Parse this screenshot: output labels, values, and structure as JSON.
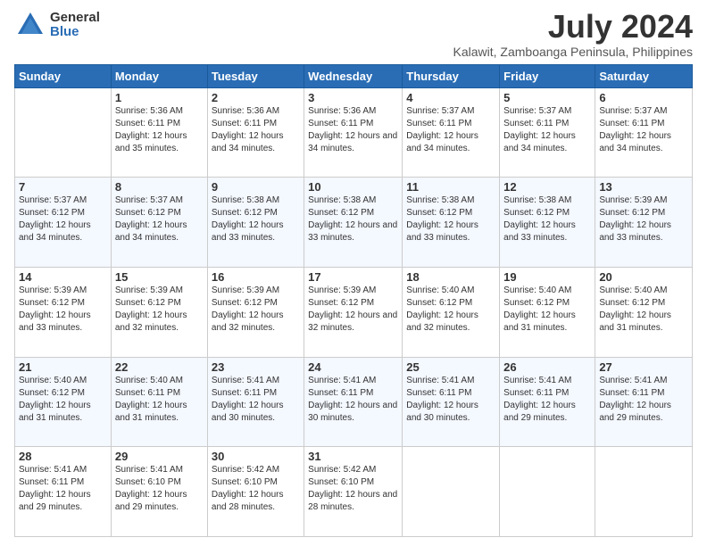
{
  "logo": {
    "general": "General",
    "blue": "Blue"
  },
  "header": {
    "month_title": "July 2024",
    "location": "Kalawit, Zamboanga Peninsula, Philippines"
  },
  "days_of_week": [
    "Sunday",
    "Monday",
    "Tuesday",
    "Wednesday",
    "Thursday",
    "Friday",
    "Saturday"
  ],
  "weeks": [
    [
      {
        "day": "",
        "sunrise": "",
        "sunset": "",
        "daylight": ""
      },
      {
        "day": "1",
        "sunrise": "Sunrise: 5:36 AM",
        "sunset": "Sunset: 6:11 PM",
        "daylight": "Daylight: 12 hours and 35 minutes."
      },
      {
        "day": "2",
        "sunrise": "Sunrise: 5:36 AM",
        "sunset": "Sunset: 6:11 PM",
        "daylight": "Daylight: 12 hours and 34 minutes."
      },
      {
        "day": "3",
        "sunrise": "Sunrise: 5:36 AM",
        "sunset": "Sunset: 6:11 PM",
        "daylight": "Daylight: 12 hours and 34 minutes."
      },
      {
        "day": "4",
        "sunrise": "Sunrise: 5:37 AM",
        "sunset": "Sunset: 6:11 PM",
        "daylight": "Daylight: 12 hours and 34 minutes."
      },
      {
        "day": "5",
        "sunrise": "Sunrise: 5:37 AM",
        "sunset": "Sunset: 6:11 PM",
        "daylight": "Daylight: 12 hours and 34 minutes."
      },
      {
        "day": "6",
        "sunrise": "Sunrise: 5:37 AM",
        "sunset": "Sunset: 6:11 PM",
        "daylight": "Daylight: 12 hours and 34 minutes."
      }
    ],
    [
      {
        "day": "7",
        "sunrise": "Sunrise: 5:37 AM",
        "sunset": "Sunset: 6:12 PM",
        "daylight": "Daylight: 12 hours and 34 minutes."
      },
      {
        "day": "8",
        "sunrise": "Sunrise: 5:37 AM",
        "sunset": "Sunset: 6:12 PM",
        "daylight": "Daylight: 12 hours and 34 minutes."
      },
      {
        "day": "9",
        "sunrise": "Sunrise: 5:38 AM",
        "sunset": "Sunset: 6:12 PM",
        "daylight": "Daylight: 12 hours and 33 minutes."
      },
      {
        "day": "10",
        "sunrise": "Sunrise: 5:38 AM",
        "sunset": "Sunset: 6:12 PM",
        "daylight": "Daylight: 12 hours and 33 minutes."
      },
      {
        "day": "11",
        "sunrise": "Sunrise: 5:38 AM",
        "sunset": "Sunset: 6:12 PM",
        "daylight": "Daylight: 12 hours and 33 minutes."
      },
      {
        "day": "12",
        "sunrise": "Sunrise: 5:38 AM",
        "sunset": "Sunset: 6:12 PM",
        "daylight": "Daylight: 12 hours and 33 minutes."
      },
      {
        "day": "13",
        "sunrise": "Sunrise: 5:39 AM",
        "sunset": "Sunset: 6:12 PM",
        "daylight": "Daylight: 12 hours and 33 minutes."
      }
    ],
    [
      {
        "day": "14",
        "sunrise": "Sunrise: 5:39 AM",
        "sunset": "Sunset: 6:12 PM",
        "daylight": "Daylight: 12 hours and 33 minutes."
      },
      {
        "day": "15",
        "sunrise": "Sunrise: 5:39 AM",
        "sunset": "Sunset: 6:12 PM",
        "daylight": "Daylight: 12 hours and 32 minutes."
      },
      {
        "day": "16",
        "sunrise": "Sunrise: 5:39 AM",
        "sunset": "Sunset: 6:12 PM",
        "daylight": "Daylight: 12 hours and 32 minutes."
      },
      {
        "day": "17",
        "sunrise": "Sunrise: 5:39 AM",
        "sunset": "Sunset: 6:12 PM",
        "daylight": "Daylight: 12 hours and 32 minutes."
      },
      {
        "day": "18",
        "sunrise": "Sunrise: 5:40 AM",
        "sunset": "Sunset: 6:12 PM",
        "daylight": "Daylight: 12 hours and 32 minutes."
      },
      {
        "day": "19",
        "sunrise": "Sunrise: 5:40 AM",
        "sunset": "Sunset: 6:12 PM",
        "daylight": "Daylight: 12 hours and 31 minutes."
      },
      {
        "day": "20",
        "sunrise": "Sunrise: 5:40 AM",
        "sunset": "Sunset: 6:12 PM",
        "daylight": "Daylight: 12 hours and 31 minutes."
      }
    ],
    [
      {
        "day": "21",
        "sunrise": "Sunrise: 5:40 AM",
        "sunset": "Sunset: 6:12 PM",
        "daylight": "Daylight: 12 hours and 31 minutes."
      },
      {
        "day": "22",
        "sunrise": "Sunrise: 5:40 AM",
        "sunset": "Sunset: 6:11 PM",
        "daylight": "Daylight: 12 hours and 31 minutes."
      },
      {
        "day": "23",
        "sunrise": "Sunrise: 5:41 AM",
        "sunset": "Sunset: 6:11 PM",
        "daylight": "Daylight: 12 hours and 30 minutes."
      },
      {
        "day": "24",
        "sunrise": "Sunrise: 5:41 AM",
        "sunset": "Sunset: 6:11 PM",
        "daylight": "Daylight: 12 hours and 30 minutes."
      },
      {
        "day": "25",
        "sunrise": "Sunrise: 5:41 AM",
        "sunset": "Sunset: 6:11 PM",
        "daylight": "Daylight: 12 hours and 30 minutes."
      },
      {
        "day": "26",
        "sunrise": "Sunrise: 5:41 AM",
        "sunset": "Sunset: 6:11 PM",
        "daylight": "Daylight: 12 hours and 29 minutes."
      },
      {
        "day": "27",
        "sunrise": "Sunrise: 5:41 AM",
        "sunset": "Sunset: 6:11 PM",
        "daylight": "Daylight: 12 hours and 29 minutes."
      }
    ],
    [
      {
        "day": "28",
        "sunrise": "Sunrise: 5:41 AM",
        "sunset": "Sunset: 6:11 PM",
        "daylight": "Daylight: 12 hours and 29 minutes."
      },
      {
        "day": "29",
        "sunrise": "Sunrise: 5:41 AM",
        "sunset": "Sunset: 6:10 PM",
        "daylight": "Daylight: 12 hours and 29 minutes."
      },
      {
        "day": "30",
        "sunrise": "Sunrise: 5:42 AM",
        "sunset": "Sunset: 6:10 PM",
        "daylight": "Daylight: 12 hours and 28 minutes."
      },
      {
        "day": "31",
        "sunrise": "Sunrise: 5:42 AM",
        "sunset": "Sunset: 6:10 PM",
        "daylight": "Daylight: 12 hours and 28 minutes."
      },
      {
        "day": "",
        "sunrise": "",
        "sunset": "",
        "daylight": ""
      },
      {
        "day": "",
        "sunrise": "",
        "sunset": "",
        "daylight": ""
      },
      {
        "day": "",
        "sunrise": "",
        "sunset": "",
        "daylight": ""
      }
    ]
  ]
}
